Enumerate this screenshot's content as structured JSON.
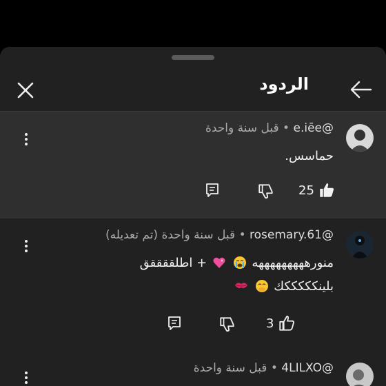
{
  "sheet": {
    "title": "الردود"
  },
  "comments": [
    {
      "handle": "@e.iēe",
      "time": "قبل سنة واحدة",
      "lines": [
        "حماسس."
      ],
      "likes": "25",
      "highlighted": true,
      "avatar_color": "#d9d9d9"
    },
    {
      "handle": "@rosemary.61",
      "time": "قبل سنة واحدة (تم تعديله)",
      "lines": [
        "منورهههههههههه",
        "+ اطلققققق",
        "بلينكككككك"
      ],
      "likes": "3",
      "highlighted": false,
      "avatar_color": "#1a2733"
    },
    {
      "handle": "@4LILXO",
      "time": "قبل سنة واحدة",
      "lines": [],
      "likes": "",
      "highlighted": false,
      "avatar_color": "#c8c8c8"
    }
  ],
  "icons": {
    "close": "close-icon",
    "back": "arrow-left-icon",
    "more": "more-vertical-icon",
    "reply": "reply-icon",
    "dislike": "dislike-icon",
    "like": "like-icon"
  },
  "colors": {
    "background": "#000000",
    "sheet": "#212121",
    "highlight": "#2f2f2f",
    "meta_text": "#aaaaaa",
    "text": "#f1f1f1"
  }
}
